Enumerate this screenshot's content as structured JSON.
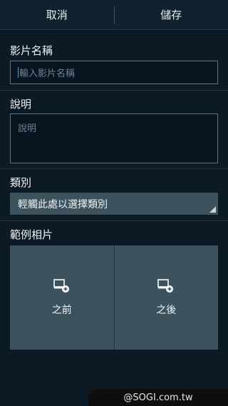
{
  "topbar": {
    "cancel_label": "取消",
    "save_label": "儲存"
  },
  "video_name": {
    "label": "影片名稱",
    "placeholder": "輸入影片名稱"
  },
  "description": {
    "label": "說明",
    "placeholder": "說明"
  },
  "category": {
    "label": "類別",
    "value": "輕觸此處以選擇類別"
  },
  "sample_photos": {
    "label": "範例相片",
    "before_label": "之前",
    "after_label": "之後"
  },
  "watermark": "@SOGI.com.tw",
  "colors": {
    "background": "#0b1a24",
    "accent_caret": "#44a6d8",
    "panel": "#3c525d"
  }
}
